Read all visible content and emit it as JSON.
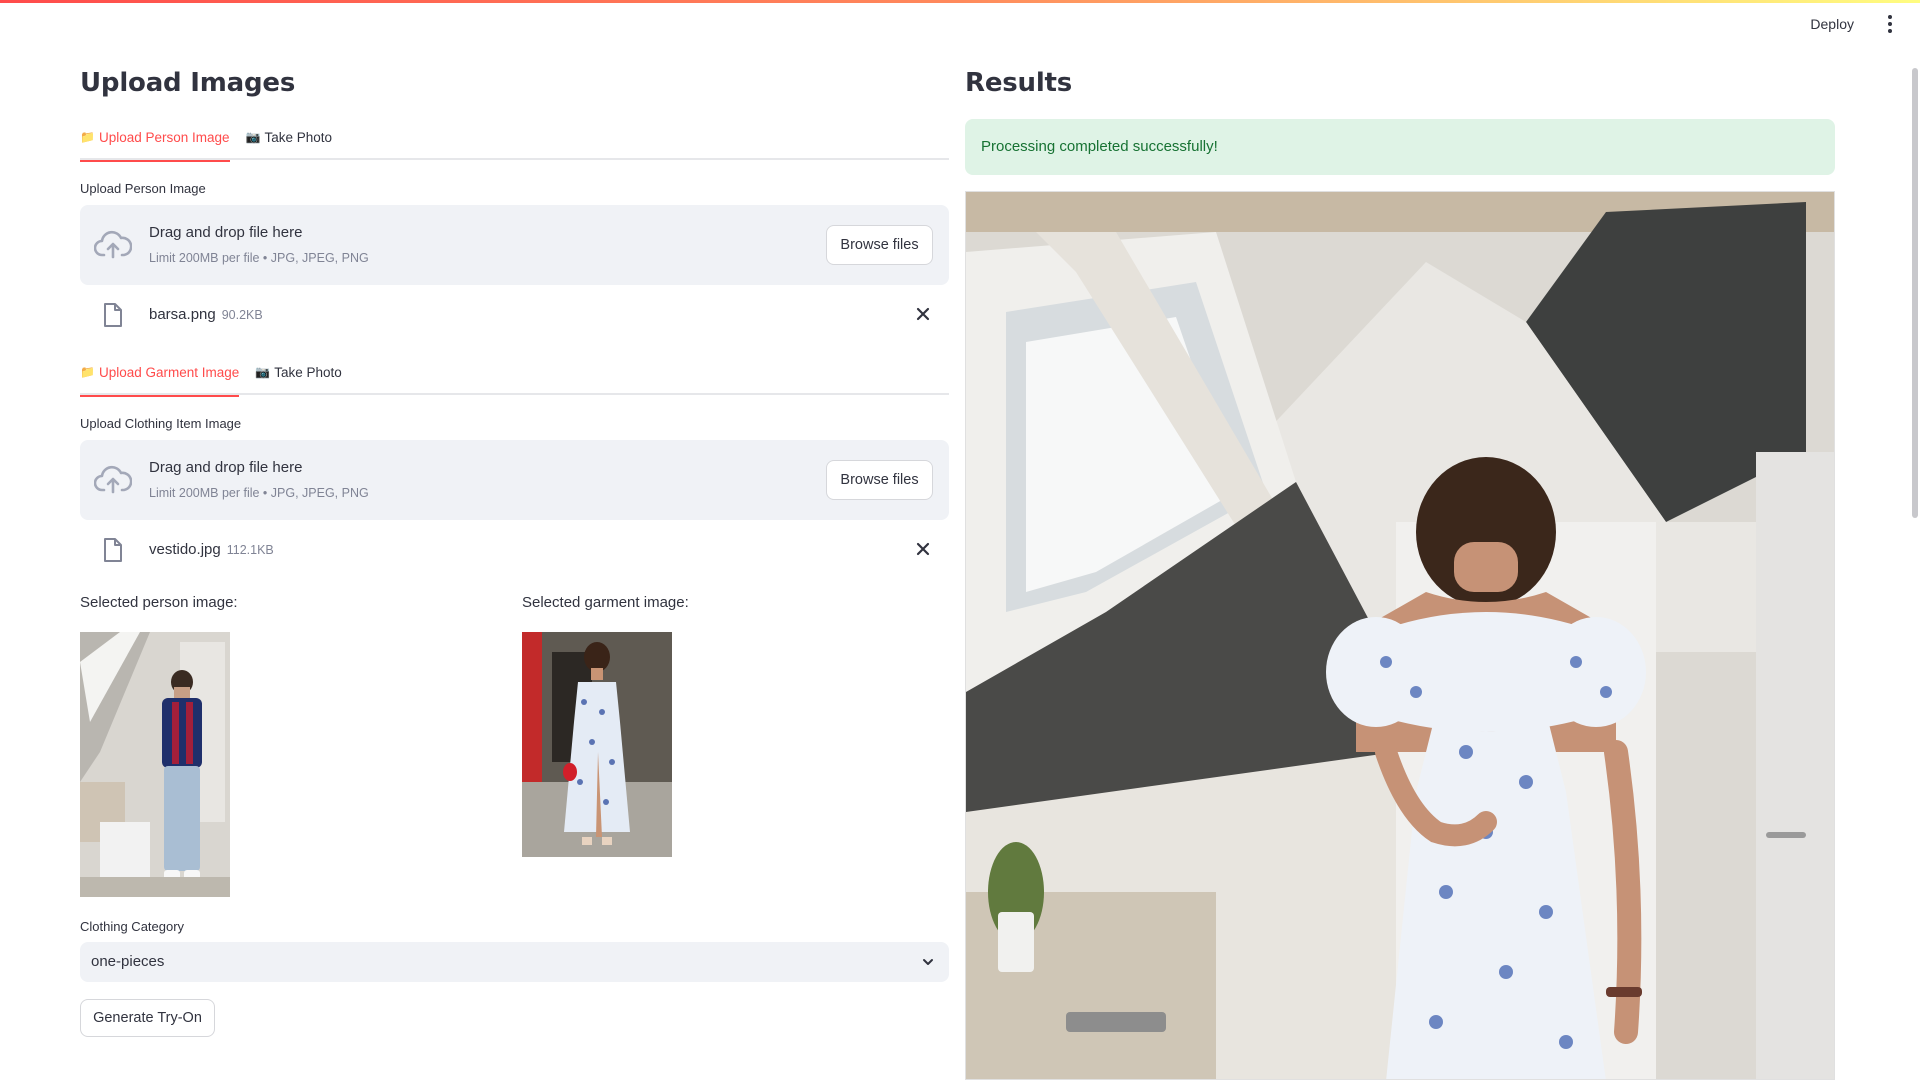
{
  "header": {
    "deploy_label": "Deploy"
  },
  "left": {
    "title": "Upload Images",
    "person_tabs": [
      {
        "icon": "📁",
        "label": "Upload Person Image",
        "active": true
      },
      {
        "icon": "📷",
        "label": "Take Photo",
        "active": false
      }
    ],
    "person_uploader": {
      "label": "Upload Person Image",
      "drop_text": "Drag and drop file here",
      "limit_text": "Limit 200MB per file • JPG, JPEG, PNG",
      "browse_label": "Browse files",
      "file_name": "barsa.png",
      "file_size": "90.2KB"
    },
    "garment_tabs": [
      {
        "icon": "📁",
        "label": "Upload Garment Image",
        "active": true
      },
      {
        "icon": "📷",
        "label": "Take Photo",
        "active": false
      }
    ],
    "garment_uploader": {
      "label": "Upload Clothing Item Image",
      "drop_text": "Drag and drop file here",
      "limit_text": "Limit 200MB per file • JPG, JPEG, PNG",
      "browse_label": "Browse files",
      "file_name": "vestido.jpg",
      "file_size": "112.1KB"
    },
    "selected_person_label": "Selected person image:",
    "selected_garment_label": "Selected garment image:",
    "category": {
      "label": "Clothing Category",
      "value": "one-pieces"
    },
    "generate_label": "Generate Try-On"
  },
  "right": {
    "title": "Results",
    "success_message": "Processing completed successfully!"
  },
  "colors": {
    "accent": "#ff4b4b",
    "success_bg": "#dff3e6",
    "success_text": "#177233",
    "input_bg": "#f0f2f6"
  }
}
